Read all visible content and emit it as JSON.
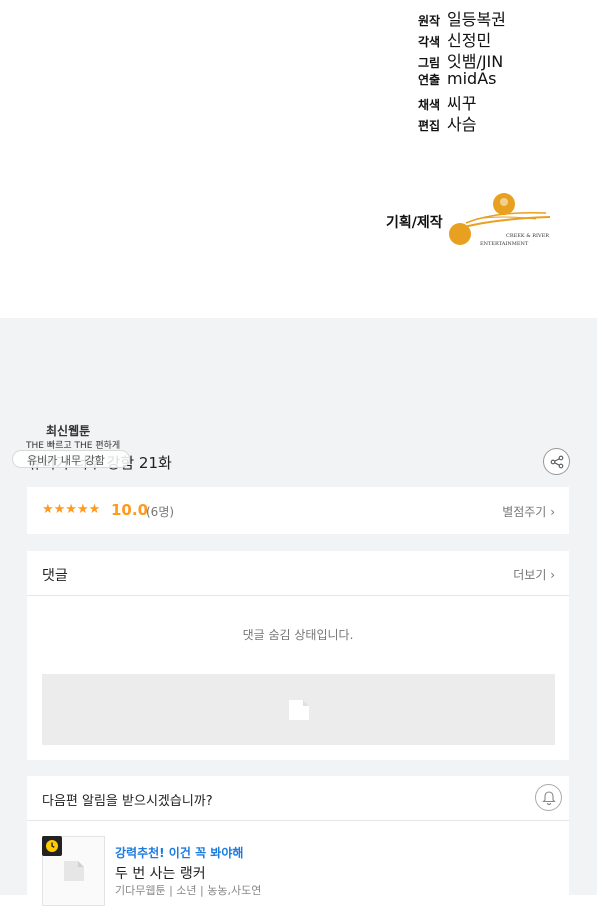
{
  "credits": {
    "rows": [
      {
        "role": "원작",
        "name": "일등복권"
      },
      {
        "role": "각색",
        "name": "신정민"
      },
      {
        "role": "그림",
        "name": "잇뱀/JIN"
      },
      {
        "role": "연출",
        "name": "midAs"
      },
      {
        "role": "채색",
        "name": "씨꾸"
      },
      {
        "role": "편집",
        "name": "사슴"
      }
    ],
    "planning_label": "기획/제작",
    "logo_text_line1": "CREEK & RIVER",
    "logo_text_line2": "ENTERTAINMENT",
    "logo_color": "#e8a020"
  },
  "overlay": {
    "top_text": "최신웹툰",
    "mid_text": "THE 빠르고 THE 편하게",
    "pill_text": "유비가 내무 강함"
  },
  "episode": {
    "title": "유비가 너무 강함 21화",
    "share_icon": "share-icon"
  },
  "rating": {
    "stars": "★★★★★",
    "score": "10.0",
    "count": "(6명)",
    "rate_link": "별점주기"
  },
  "comments": {
    "title": "댓글",
    "more": "더보기",
    "hidden_message": "댓글 숨김 상태입니다."
  },
  "notify": {
    "question": "다음편 알림을 받으시겠습니까?",
    "bell_icon": "bell-icon"
  },
  "recommendation": {
    "tag": "강력추천! 이건 꼭 봐야해",
    "title": "두 번 사는 랭커",
    "meta": "기다무웹툰 | 소년 | 농농,사도연"
  },
  "colors": {
    "accent_orange": "#ff9a1f",
    "link_blue": "#1b7be0",
    "background_gray": "#f2f3f5"
  }
}
